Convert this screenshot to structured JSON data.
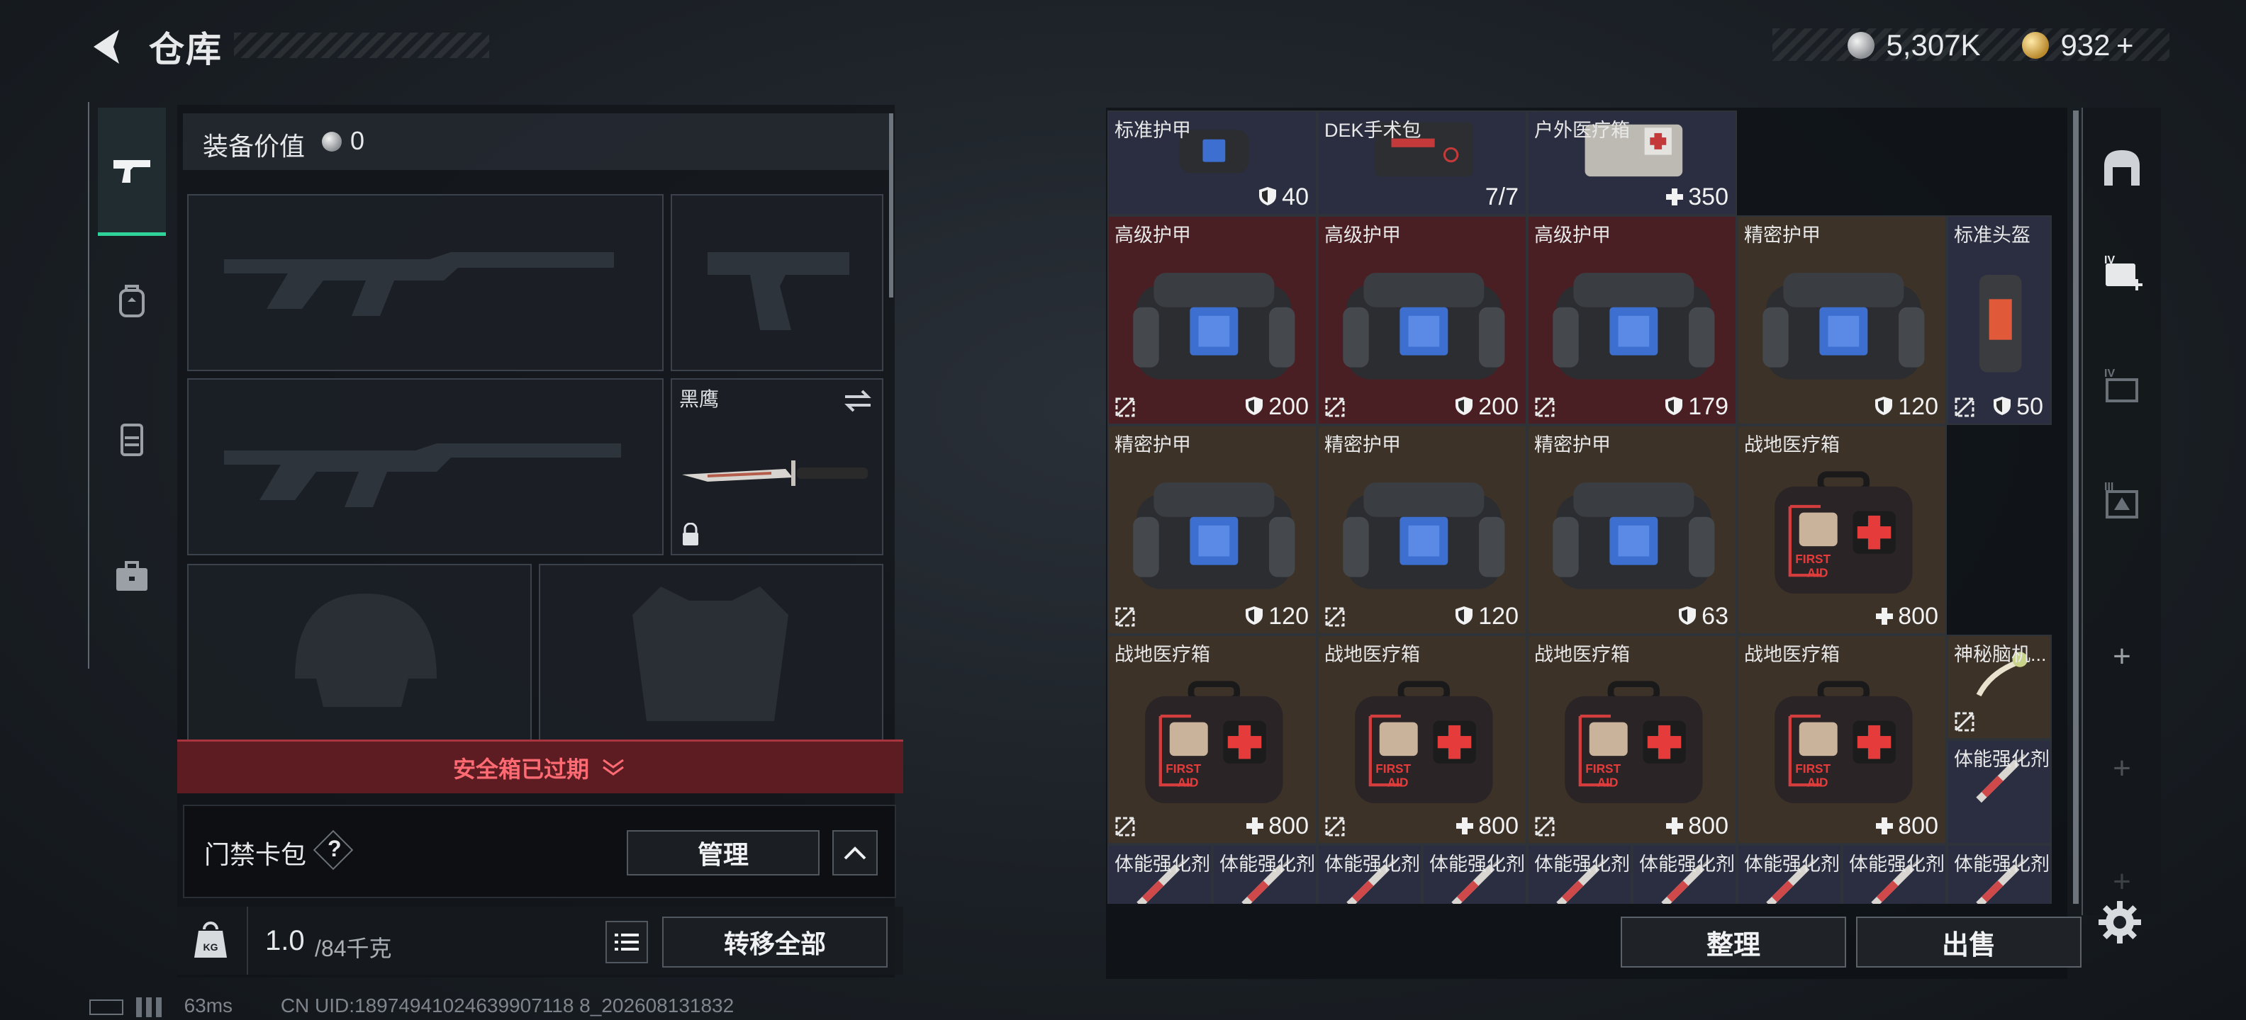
{
  "header": {
    "title": "仓库"
  },
  "currency": {
    "silver": "5,307K",
    "gold": "932",
    "plus": "+"
  },
  "equip": {
    "value_label": "装备价值",
    "value": "0",
    "melee_name": "黑鹰",
    "safebox_text": "安全箱已过期",
    "cardpack_label": "门禁卡包",
    "help": "?",
    "manage": "管理",
    "weight_value": "1.0",
    "weight_max": "/84千克",
    "transfer_all": "转移全部",
    "kg": "KG"
  },
  "actions": {
    "sort": "整理",
    "sell": "出售"
  },
  "sidebar": {
    "add": "+"
  },
  "items": [
    {
      "name": "标准护甲",
      "value": "40",
      "kind": "armor-small",
      "icon": "shield"
    },
    {
      "name": "DEK手术包",
      "value": "7/7",
      "kind": "surgery",
      "icon": ""
    },
    {
      "name": "户外医疗箱",
      "value": "350",
      "kind": "medbox-grey",
      "icon": "plus"
    },
    {
      "name": "高级护甲",
      "value": "200",
      "kind": "armor",
      "icon": "shield"
    },
    {
      "name": "高级护甲",
      "value": "200",
      "kind": "armor",
      "icon": "shield"
    },
    {
      "name": "高级护甲",
      "value": "179",
      "kind": "armor",
      "icon": "shield"
    },
    {
      "name": "精密护甲",
      "value": "120",
      "kind": "armor",
      "icon": "shield"
    },
    {
      "name": "标准头盔",
      "value": "50",
      "kind": "helmet",
      "icon": "shield"
    },
    {
      "name": "精密护甲",
      "value": "120",
      "kind": "armor",
      "icon": "shield"
    },
    {
      "name": "精密护甲",
      "value": "120",
      "kind": "armor",
      "icon": "shield"
    },
    {
      "name": "精密护甲",
      "value": "63",
      "kind": "armor",
      "icon": "shield"
    },
    {
      "name": "战地医疗箱",
      "value": "800",
      "kind": "firstaid",
      "icon": "plus"
    },
    {
      "name": "战地医疗箱",
      "value": "800",
      "kind": "firstaid",
      "icon": "plus"
    },
    {
      "name": "战地医疗箱",
      "value": "800",
      "kind": "firstaid",
      "icon": "plus"
    },
    {
      "name": "战地医疗箱",
      "value": "800",
      "kind": "firstaid",
      "icon": "plus"
    },
    {
      "name": "战地医疗箱",
      "value": "800",
      "kind": "firstaid",
      "icon": "plus"
    },
    {
      "name": "神秘脑机...",
      "value": "",
      "kind": "chip",
      "icon": ""
    },
    {
      "name": "体能强化剂",
      "value": "",
      "kind": "syringe",
      "icon": ""
    },
    {
      "name": "体能强化剂",
      "value": "",
      "kind": "syringe",
      "icon": ""
    },
    {
      "name": "体能强化剂",
      "value": "",
      "kind": "syringe",
      "icon": ""
    },
    {
      "name": "体能强化剂",
      "value": "",
      "kind": "syringe",
      "icon": ""
    },
    {
      "name": "体能强化剂",
      "value": "",
      "kind": "syringe",
      "icon": ""
    },
    {
      "name": "体能强化剂",
      "value": "",
      "kind": "syringe",
      "icon": ""
    },
    {
      "name": "体能强化剂",
      "value": "",
      "kind": "syringe",
      "icon": ""
    },
    {
      "name": "体能强化剂",
      "value": "",
      "kind": "syringe",
      "icon": ""
    },
    {
      "name": "体能强化剂",
      "value": "",
      "kind": "syringe",
      "icon": ""
    },
    {
      "name": "体能强化剂",
      "value": "",
      "kind": "syringe",
      "icon": ""
    }
  ],
  "status": {
    "ping": "63ms",
    "uid": "CN UID:18974941024639907118 8_202608131832"
  },
  "colors": {
    "accent": "#2fd39a",
    "danger": "#ff6a73",
    "rarity_red": "#4a1f24",
    "rarity_brown": "#3c3228",
    "rarity_grey": "#2a2e40"
  }
}
